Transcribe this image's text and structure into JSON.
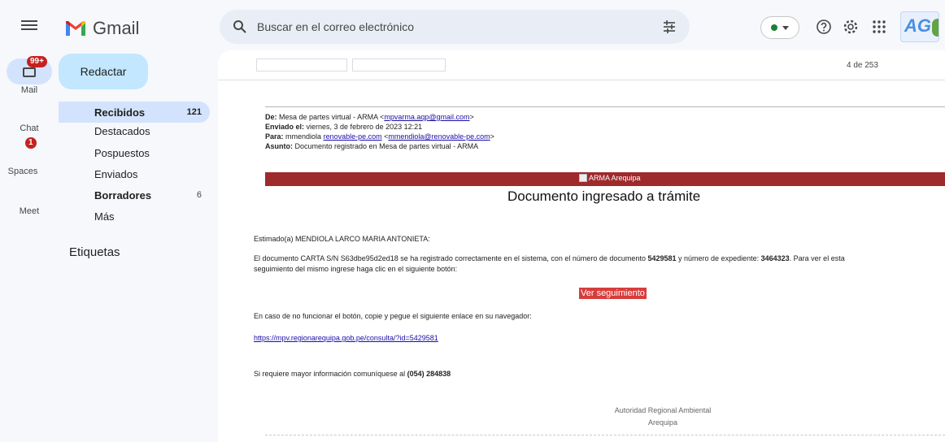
{
  "app": {
    "name": "Gmail"
  },
  "rail": {
    "mail_label": "Mail",
    "mail_badge": "99+",
    "chat_label": "Chat",
    "chat_badge": "1",
    "spaces_label": "Spaces",
    "meet_label": "Meet"
  },
  "search": {
    "placeholder": "Buscar en el correo electrónico"
  },
  "account": {
    "initials": "AG",
    "status_color": "#188038"
  },
  "nav": {
    "compose_label": "Redactar",
    "items": [
      {
        "label": "Recibidos",
        "count": "121"
      },
      {
        "label": "Destacados",
        "count": ""
      },
      {
        "label": "Pospuestos",
        "count": ""
      },
      {
        "label": "Enviados",
        "count": ""
      },
      {
        "label": "Borradores",
        "count": "6"
      },
      {
        "label": "Más",
        "count": ""
      }
    ],
    "labels_heading": "Etiquetas"
  },
  "message": {
    "pager": "4 de 253",
    "from_label": "De:",
    "from_value": "Mesa de partes virtual - ARMA <",
    "from_email": "mpvarma.aqp@gmail.com",
    "from_tail": ">",
    "sent_label": "Enviado el:",
    "sent_value": "viernes, 3 de febrero de 2023 12:21",
    "to_label": "Para:",
    "to_name": "mmendiola",
    "to_link": "renovable-pe.com",
    "to_lt": "<",
    "to_email": "mmendiola@renovable-pe.com",
    "to_gt": ">",
    "subject_label": "Asunto:",
    "subject_value": "Documento registrado en Mesa de partes virtual - ARMA",
    "banner_alt": "ARMA Arequipa",
    "banner_color": "#9e2a2b",
    "doc_title": "Documento ingresado a trámite",
    "greeting": "Estimado(a) MENDIOLA LARCO MARIA ANTONIETA:",
    "para1_a": "El documento CARTA S/N S63dbe95d2ed18 se ha registrado correctamente en el sistema, con el número de documento",
    "doc_number": "5429581",
    "para1_b": "y número de expediente:",
    "exp_number": "3464323",
    "para1_c": ". Para ver el esta",
    "para1_line2": "seguimiento del mismo ingrese haga clic en el siguiente botón:",
    "follow_button": "Ver seguimiento",
    "fallback_text": "En caso de no funcionar el botón, copie y pegue el siguiente enlace en su navegador:",
    "fallback_url": "https://mpv.regionarequipa.gob.pe/consulta/?id=5429581",
    "info_text": "Si requiere mayor información comuníquese al",
    "info_phone": "(054) 284838",
    "org_line1": "Autoridad Regional Ambiental",
    "org_line2": "Arequipa"
  }
}
